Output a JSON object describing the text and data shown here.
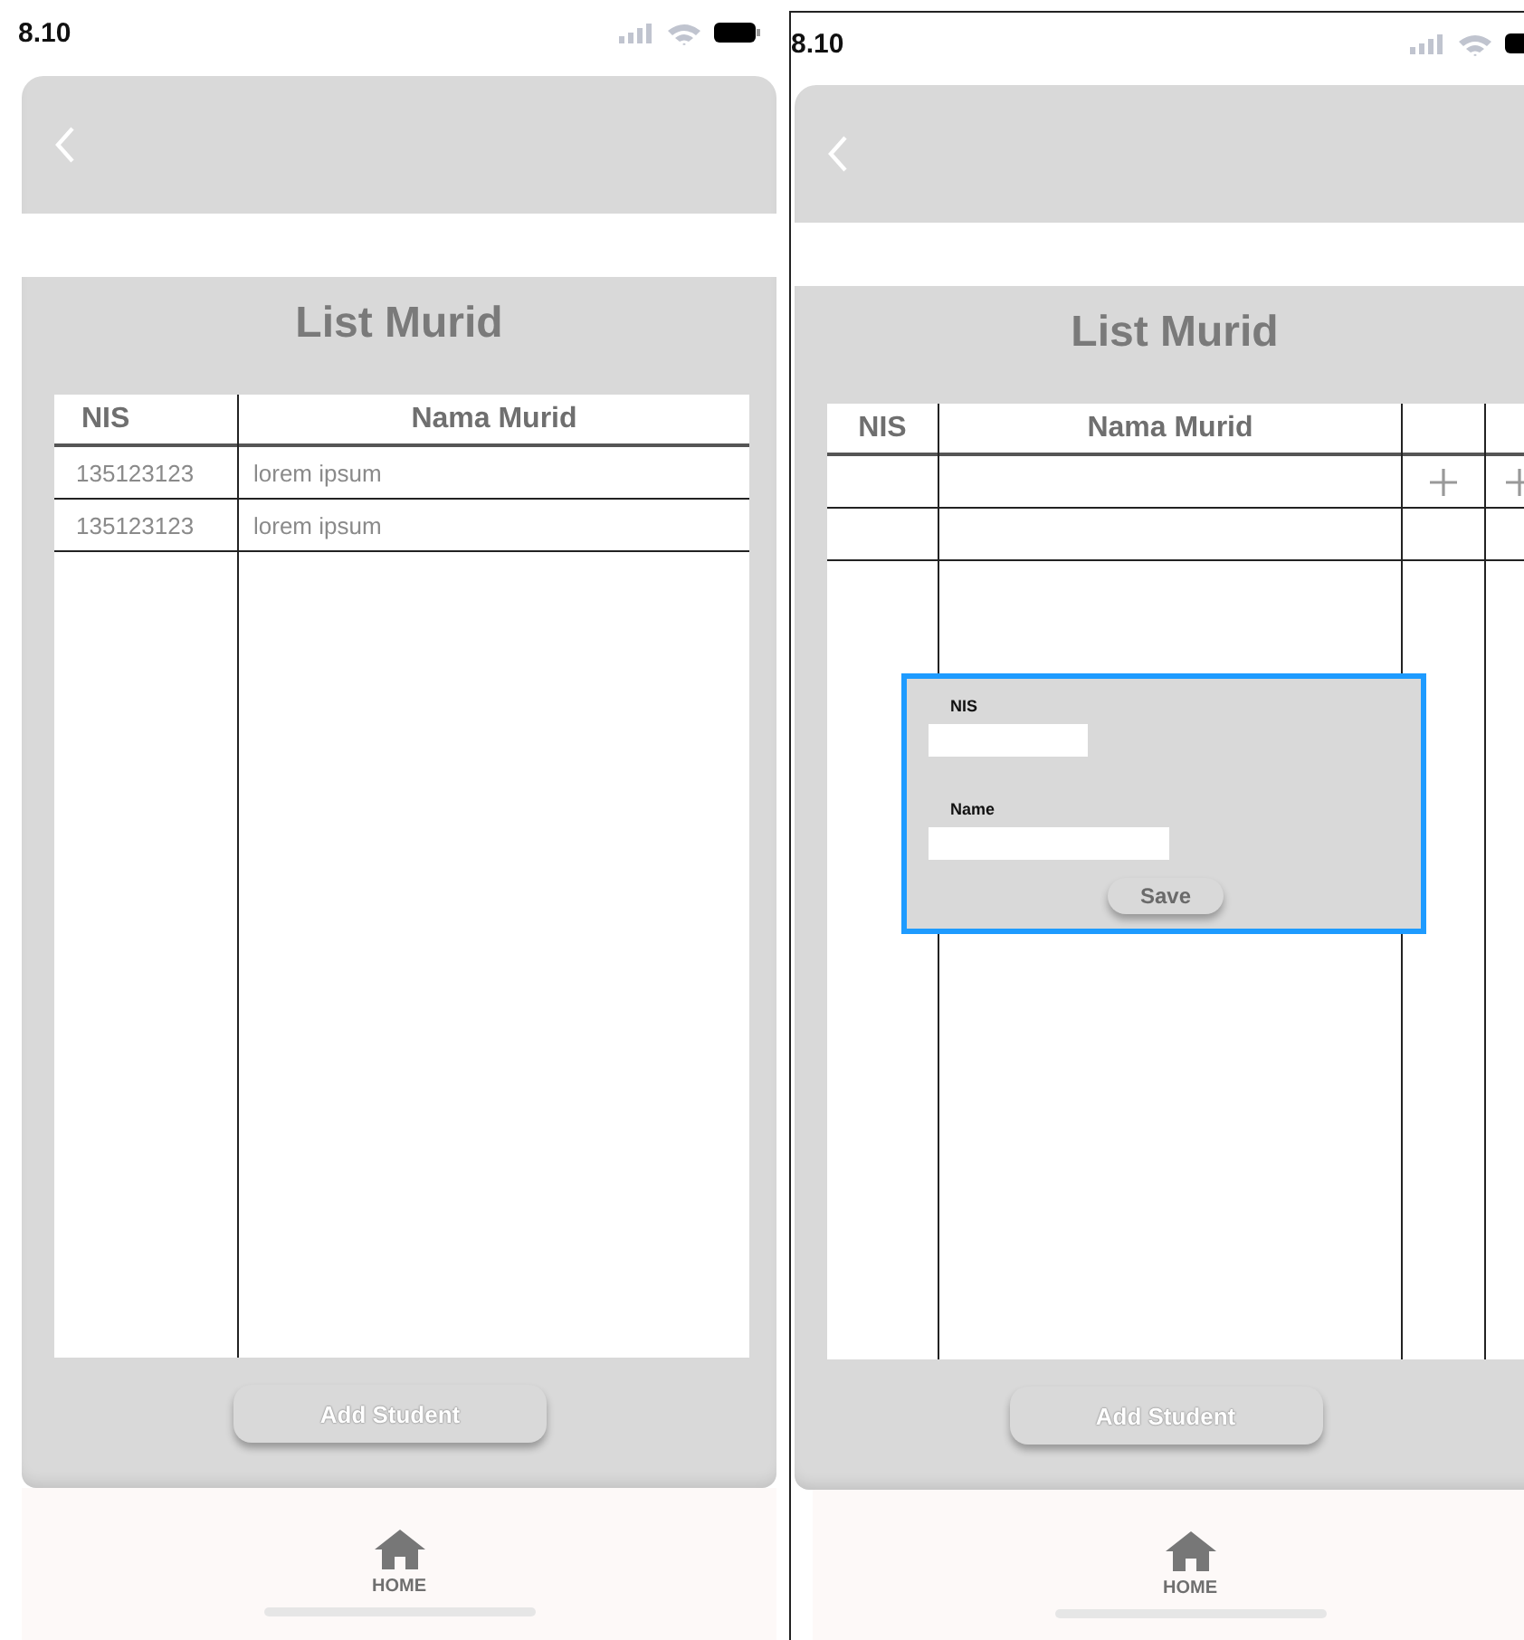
{
  "screens": [
    {
      "status_bar": {
        "time": "8.10"
      },
      "title": "List Murid",
      "table": {
        "columns": [
          "NIS",
          "Nama Murid"
        ],
        "rows": [
          {
            "kind": "data",
            "cells": [
              "135123123",
              "lorem ipsum"
            ]
          },
          {
            "kind": "data",
            "cells": [
              "135123123",
              "lorem ipsum"
            ]
          }
        ]
      },
      "button": "Add Student",
      "nav": {
        "label": "HOME"
      }
    },
    {
      "status_bar": {
        "time": "8.10"
      },
      "title": "List Murid",
      "table": {
        "columns": [
          "NIS",
          "Nama Murid"
        ],
        "action_columns": [
          {
            "kind": "add"
          },
          {
            "kind": "add"
          }
        ],
        "rows": [
          {
            "kind": "actions"
          },
          {
            "kind": "blank"
          }
        ]
      },
      "dialog": {
        "fields": [
          {
            "label": "NIS",
            "kind": "short"
          },
          {
            "label": "Name",
            "kind": "long"
          }
        ],
        "button": "Save"
      },
      "button": "Add Student",
      "nav": {
        "label": "HOME"
      }
    }
  ]
}
